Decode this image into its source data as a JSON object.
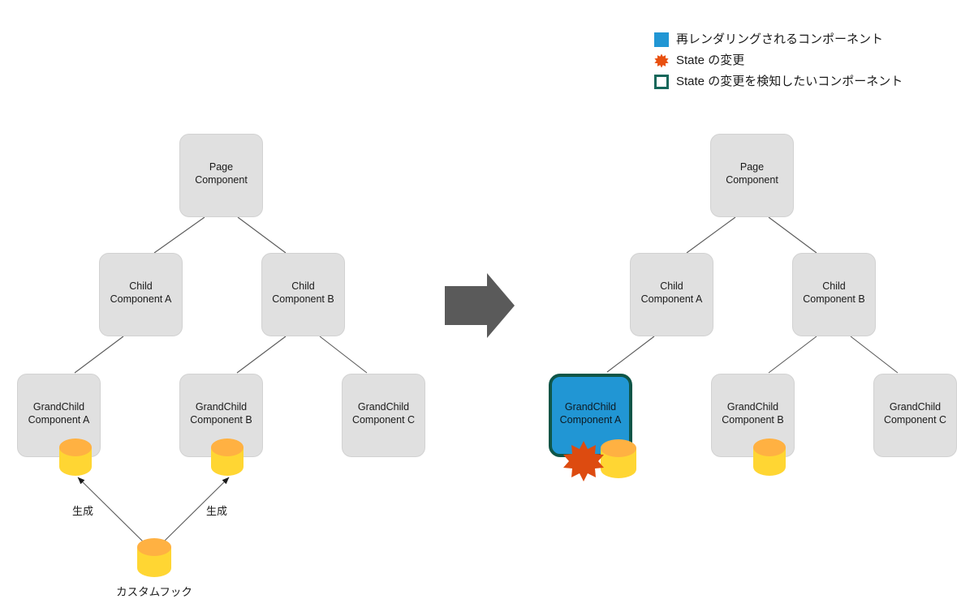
{
  "legend": {
    "items": [
      {
        "icon": "filled-square-icon",
        "label": "再レンダリングされるコンポーネント"
      },
      {
        "icon": "burst-icon",
        "label": "State の変更"
      },
      {
        "icon": "outlined-square-icon",
        "label": "State の変更を検知したいコンポーネント"
      }
    ]
  },
  "colors": {
    "node_fill": "#e0e0e0",
    "node_border": "#d2d2d2",
    "highlight_fill": "#2196d4",
    "highlight_border": "#0e5547",
    "burst": "#dd4b10",
    "cylinder_body": "#ffd633",
    "cylinder_top": "#ffb142",
    "edge_line": "#5a5a5a",
    "big_arrow": "#5a5a5a",
    "legend_outline": "#15675a",
    "text": "#1a1a1a"
  },
  "before_tree": {
    "nodes": {
      "page": "Page\nComponent",
      "child_a": "Child\nComponent A",
      "child_b": "Child\nComponent B",
      "grandchild_a": "GrandChild\nComponent A",
      "grandchild_b": "GrandChild\nComponent B",
      "grandchild_c": "GrandChild\nComponent C"
    },
    "hook": {
      "label": "カスタムフック",
      "edge_label_left": "生成",
      "edge_label_right": "生成"
    }
  },
  "after_tree": {
    "nodes": {
      "page": "Page\nComponent",
      "child_a": "Child\nComponent A",
      "child_b": "Child\nComponent B",
      "grandchild_a": "GrandChild\nComponent A",
      "grandchild_b": "GrandChild\nComponent B",
      "grandchild_c": "GrandChild\nComponent C"
    }
  },
  "transition": {
    "icon": "right-arrow-icon"
  }
}
